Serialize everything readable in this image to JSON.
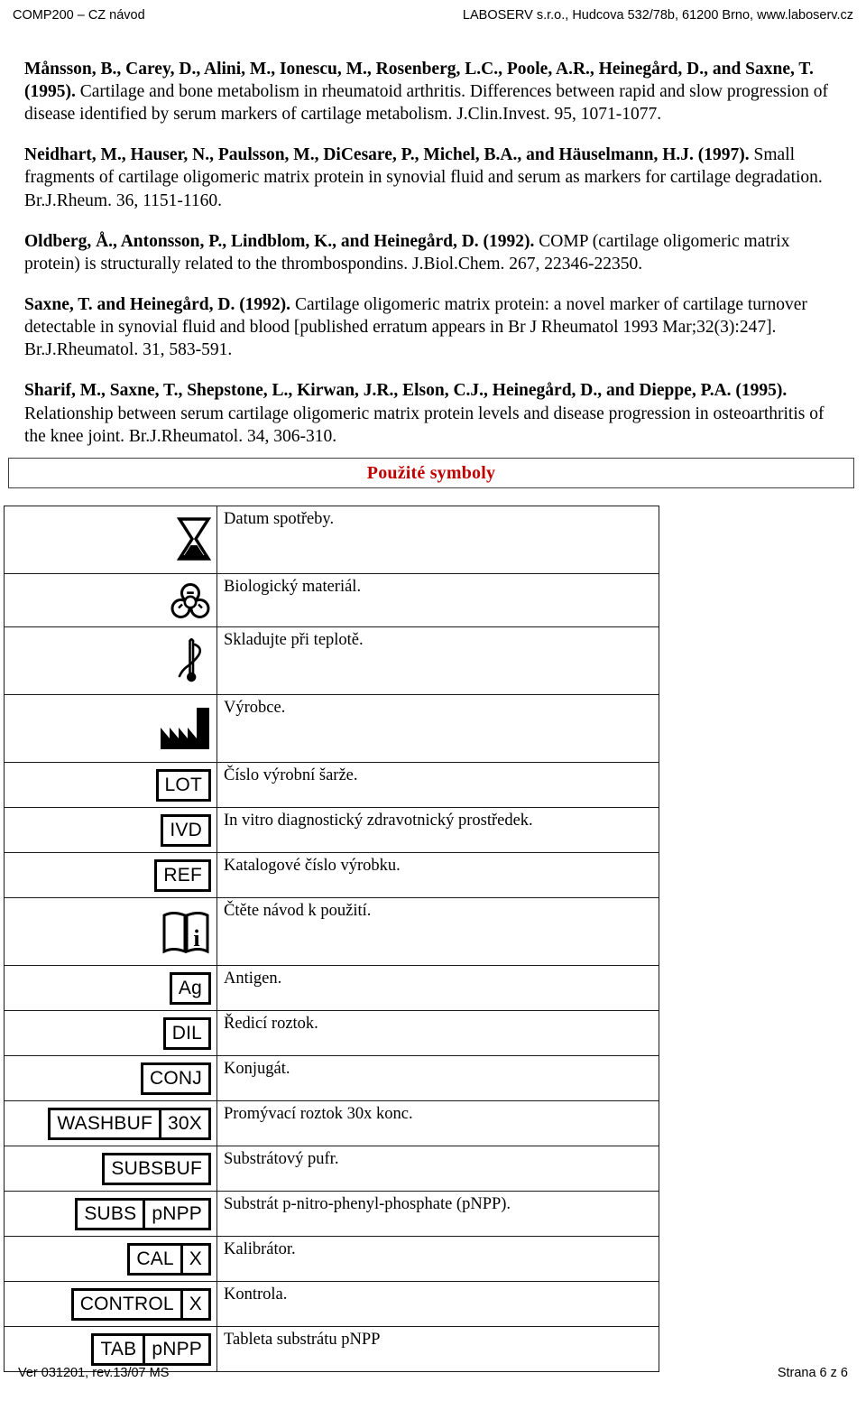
{
  "header": {
    "left": "COMP200 – CZ návod",
    "right": "LABOSERV s.r.o., Hudcova 532/78b, 61200 Brno, www.laboserv.cz"
  },
  "footer": {
    "left": "Ver 031201, rev.13/07 MS",
    "right": "Strana 6 z 6"
  },
  "colors": {
    "title_red": "#c00000",
    "rule": "#3f3f3f",
    "text": "#000000"
  },
  "references": [
    {
      "authors": "Månsson, B., Carey, D., Alini, M., Ionescu, M., Rosenberg, L.C., Poole, A.R., Heinegård, D., and Saxne, T. (1995).",
      "body": " Cartilage and bone metabolism in rheumatoid arthritis. Differences between rapid and slow progression of disease identified by serum markers of cartilage metabolism.  J.Clin.Invest. 95, 1071-1077."
    },
    {
      "authors": "Neidhart, M., Hauser, N., Paulsson, M., DiCesare, P., Michel, B.A., and Häuselmann, H.J. (1997).",
      "body": " Small fragments of cartilage oligomeric matrix protein in synovial fluid and serum as markers for cartilage degradation. Br.J.Rheum. 36, 1151-1160."
    },
    {
      "authors": "Oldberg, Å., Antonsson, P., Lindblom, K., and Heinegård, D. (1992).",
      "body": " COMP (cartilage oligomeric matrix protein) is structurally related to the thrombospondins.  J.Biol.Chem. 267, 22346-22350."
    },
    {
      "authors": "Saxne, T. and Heinegård, D. (1992).",
      "body": " Cartilage oligomeric matrix protein: a novel marker of cartilage turnover detectable in synovial fluid and blood [published erratum appears in Br J Rheumatol 1993 Mar;32(3):247]. Br.J.Rheumatol. 31, 583-591."
    },
    {
      "authors": "Sharif, M., Saxne, T., Shepstone, L., Kirwan, J.R., Elson, C.J., Heinegård, D., and Dieppe, P.A. (1995).",
      "body": " Relationship between serum cartilage oligomeric matrix protein levels and disease progression in osteoarthritis of the knee joint.  Br.J.Rheumatol. 34, 306-310."
    }
  ],
  "section_title": "Použité symboly",
  "symbols": [
    {
      "icon": "hourglass-icon",
      "kind": "glyph",
      "labels": [],
      "description": "Datum spotřeby."
    },
    {
      "icon": "biohazard-icon",
      "kind": "glyph",
      "labels": [],
      "description": "Biologický materiál."
    },
    {
      "icon": "thermometer-icon",
      "kind": "glyph",
      "labels": [],
      "description": "Skladujte při teplotě."
    },
    {
      "icon": "factory-icon",
      "kind": "glyph",
      "labels": [],
      "description": "Výrobce."
    },
    {
      "icon": "lot-box-icon",
      "kind": "box",
      "labels": [
        "LOT"
      ],
      "description": "Číslo výrobní šarže."
    },
    {
      "icon": "ivd-box-icon",
      "kind": "box",
      "labels": [
        "IVD"
      ],
      "description": "In vitro diagnostický zdravotnický prostředek."
    },
    {
      "icon": "ref-box-icon",
      "kind": "box",
      "labels": [
        "REF"
      ],
      "description": "Katalogové číslo výrobku."
    },
    {
      "icon": "instructions-booklet-icon",
      "kind": "glyph",
      "labels": [
        "i"
      ],
      "description": "Čtěte návod k použití."
    },
    {
      "icon": "ag-box-icon",
      "kind": "box",
      "labels": [
        "Ag"
      ],
      "description": "Antigen."
    },
    {
      "icon": "dil-box-icon",
      "kind": "box",
      "labels": [
        "DIL"
      ],
      "description": "Ředicí roztok."
    },
    {
      "icon": "conj-box-icon",
      "kind": "box",
      "labels": [
        "CONJ"
      ],
      "description": "Konjugát."
    },
    {
      "icon": "washbuf-30x-box-icon",
      "kind": "box",
      "labels": [
        "WASHBUF",
        "30X"
      ],
      "description": "Promývací roztok 30x konc."
    },
    {
      "icon": "subsbuf-box-icon",
      "kind": "box",
      "labels": [
        "SUBSBUF"
      ],
      "description": "Substrátový pufr."
    },
    {
      "icon": "subs-pnpp-box-icon",
      "kind": "box",
      "labels": [
        "SUBS",
        "pNPP"
      ],
      "description": "Substrát p-nitro-phenyl-phosphate (pNPP)."
    },
    {
      "icon": "cal-x-box-icon",
      "kind": "box",
      "labels": [
        "CAL",
        "X"
      ],
      "description": "Kalibrátor."
    },
    {
      "icon": "control-x-box-icon",
      "kind": "box",
      "labels": [
        "CONTROL",
        "X"
      ],
      "description": "Kontrola."
    },
    {
      "icon": "tab-pnpp-box-icon",
      "kind": "box",
      "labels": [
        "TAB",
        "pNPP"
      ],
      "description": "Tableta substrátu pNPP"
    }
  ]
}
